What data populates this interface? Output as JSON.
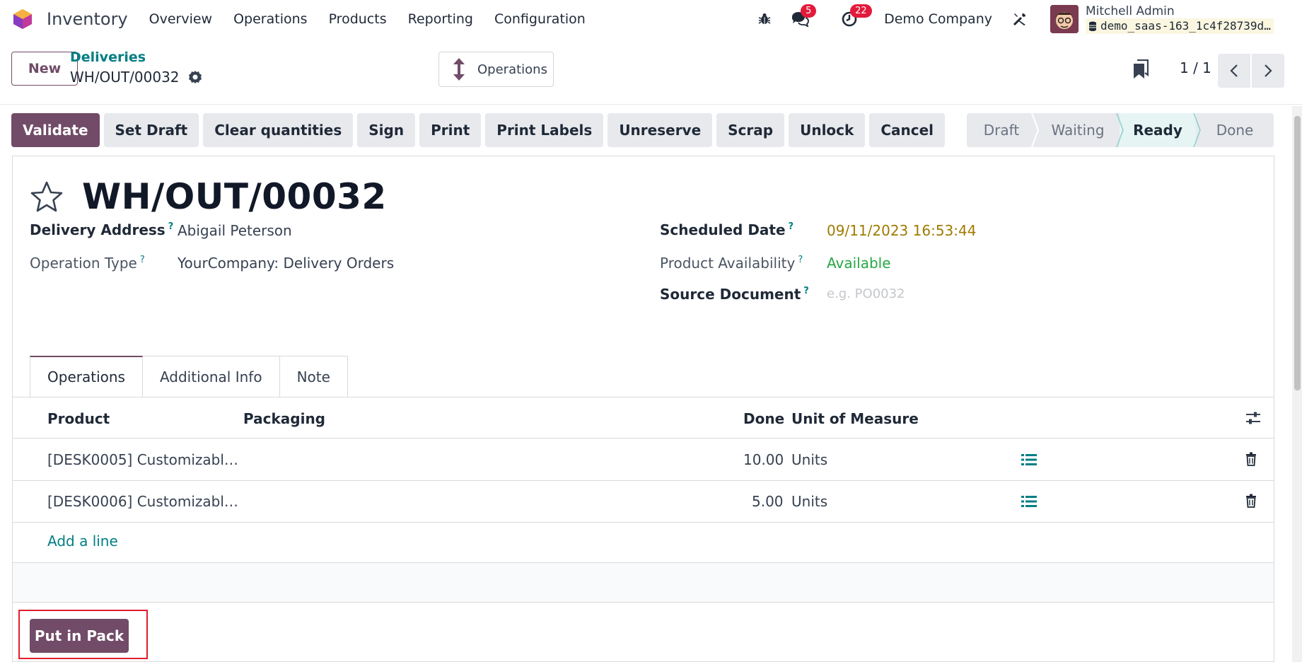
{
  "navbar": {
    "app_name": "Inventory",
    "menu": [
      "Overview",
      "Operations",
      "Products",
      "Reporting",
      "Configuration"
    ],
    "chat_badge": "5",
    "activity_badge": "22",
    "company": "Demo Company",
    "user_name": "Mitchell Admin",
    "db_name": "demo_saas-163_1c4f28739d…"
  },
  "control": {
    "new_label": "New",
    "breadcrumb_parent": "Deliveries",
    "breadcrumb_current": "WH/OUT/00032",
    "operations_label": "Operations",
    "pager": "1 / 1"
  },
  "actions": [
    "Validate",
    "Set Draft",
    "Clear quantities",
    "Sign",
    "Print",
    "Print Labels",
    "Unreserve",
    "Scrap",
    "Unlock",
    "Cancel"
  ],
  "status": {
    "stages": [
      "Draft",
      "Waiting",
      "Ready",
      "Done"
    ],
    "active": "Ready"
  },
  "form": {
    "title": "WH/OUT/00032",
    "delivery_address_label": "Delivery Address",
    "delivery_address": "Abigail Peterson",
    "operation_type_label": "Operation Type",
    "operation_type": "YourCompany: Delivery Orders",
    "scheduled_date_label": "Scheduled Date",
    "scheduled_date": "09/11/2023 16:53:44",
    "availability_label": "Product Availability",
    "availability": "Available",
    "source_document_label": "Source Document",
    "source_document_placeholder": "e.g. PO0032"
  },
  "tabs": [
    "Operations",
    "Additional Info",
    "Note"
  ],
  "table": {
    "headers": {
      "product": "Product",
      "packaging": "Packaging",
      "done": "Done",
      "uom": "Unit of Measure"
    },
    "rows": [
      {
        "product": "[DESK0005] Customizabl…",
        "done": "10.00",
        "uom": "Units"
      },
      {
        "product": "[DESK0006] Customizabl…",
        "done": "5.00",
        "uom": "Units"
      }
    ],
    "add_line": "Add a line"
  },
  "put_in_pack": "Put in Pack",
  "colors": {
    "primary": "#714b67",
    "teal": "#017e84",
    "badge": "#e21a3c"
  }
}
